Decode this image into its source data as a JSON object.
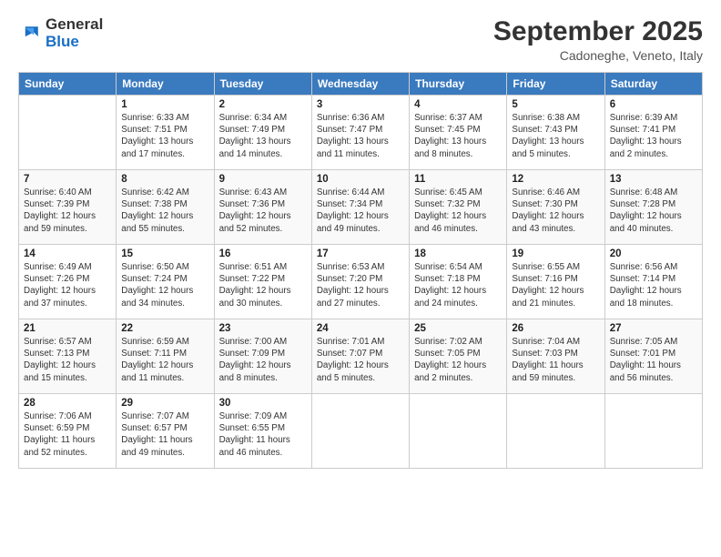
{
  "logo": {
    "general": "General",
    "blue": "Blue"
  },
  "title": "September 2025",
  "location": "Cadoneghe, Veneto, Italy",
  "days_of_week": [
    "Sunday",
    "Monday",
    "Tuesday",
    "Wednesday",
    "Thursday",
    "Friday",
    "Saturday"
  ],
  "weeks": [
    [
      {
        "day": null,
        "info": null
      },
      {
        "day": "1",
        "sunrise": "6:33 AM",
        "sunset": "7:51 PM",
        "daylight": "13 hours and 17 minutes."
      },
      {
        "day": "2",
        "sunrise": "6:34 AM",
        "sunset": "7:49 PM",
        "daylight": "13 hours and 14 minutes."
      },
      {
        "day": "3",
        "sunrise": "6:36 AM",
        "sunset": "7:47 PM",
        "daylight": "13 hours and 11 minutes."
      },
      {
        "day": "4",
        "sunrise": "6:37 AM",
        "sunset": "7:45 PM",
        "daylight": "13 hours and 8 minutes."
      },
      {
        "day": "5",
        "sunrise": "6:38 AM",
        "sunset": "7:43 PM",
        "daylight": "13 hours and 5 minutes."
      },
      {
        "day": "6",
        "sunrise": "6:39 AM",
        "sunset": "7:41 PM",
        "daylight": "13 hours and 2 minutes."
      }
    ],
    [
      {
        "day": "7",
        "sunrise": "6:40 AM",
        "sunset": "7:39 PM",
        "daylight": "12 hours and 59 minutes."
      },
      {
        "day": "8",
        "sunrise": "6:42 AM",
        "sunset": "7:38 PM",
        "daylight": "12 hours and 55 minutes."
      },
      {
        "day": "9",
        "sunrise": "6:43 AM",
        "sunset": "7:36 PM",
        "daylight": "12 hours and 52 minutes."
      },
      {
        "day": "10",
        "sunrise": "6:44 AM",
        "sunset": "7:34 PM",
        "daylight": "12 hours and 49 minutes."
      },
      {
        "day": "11",
        "sunrise": "6:45 AM",
        "sunset": "7:32 PM",
        "daylight": "12 hours and 46 minutes."
      },
      {
        "day": "12",
        "sunrise": "6:46 AM",
        "sunset": "7:30 PM",
        "daylight": "12 hours and 43 minutes."
      },
      {
        "day": "13",
        "sunrise": "6:48 AM",
        "sunset": "7:28 PM",
        "daylight": "12 hours and 40 minutes."
      }
    ],
    [
      {
        "day": "14",
        "sunrise": "6:49 AM",
        "sunset": "7:26 PM",
        "daylight": "12 hours and 37 minutes."
      },
      {
        "day": "15",
        "sunrise": "6:50 AM",
        "sunset": "7:24 PM",
        "daylight": "12 hours and 34 minutes."
      },
      {
        "day": "16",
        "sunrise": "6:51 AM",
        "sunset": "7:22 PM",
        "daylight": "12 hours and 30 minutes."
      },
      {
        "day": "17",
        "sunrise": "6:53 AM",
        "sunset": "7:20 PM",
        "daylight": "12 hours and 27 minutes."
      },
      {
        "day": "18",
        "sunrise": "6:54 AM",
        "sunset": "7:18 PM",
        "daylight": "12 hours and 24 minutes."
      },
      {
        "day": "19",
        "sunrise": "6:55 AM",
        "sunset": "7:16 PM",
        "daylight": "12 hours and 21 minutes."
      },
      {
        "day": "20",
        "sunrise": "6:56 AM",
        "sunset": "7:14 PM",
        "daylight": "12 hours and 18 minutes."
      }
    ],
    [
      {
        "day": "21",
        "sunrise": "6:57 AM",
        "sunset": "7:13 PM",
        "daylight": "12 hours and 15 minutes."
      },
      {
        "day": "22",
        "sunrise": "6:59 AM",
        "sunset": "7:11 PM",
        "daylight": "12 hours and 11 minutes."
      },
      {
        "day": "23",
        "sunrise": "7:00 AM",
        "sunset": "7:09 PM",
        "daylight": "12 hours and 8 minutes."
      },
      {
        "day": "24",
        "sunrise": "7:01 AM",
        "sunset": "7:07 PM",
        "daylight": "12 hours and 5 minutes."
      },
      {
        "day": "25",
        "sunrise": "7:02 AM",
        "sunset": "7:05 PM",
        "daylight": "12 hours and 2 minutes."
      },
      {
        "day": "26",
        "sunrise": "7:04 AM",
        "sunset": "7:03 PM",
        "daylight": "11 hours and 59 minutes."
      },
      {
        "day": "27",
        "sunrise": "7:05 AM",
        "sunset": "7:01 PM",
        "daylight": "11 hours and 56 minutes."
      }
    ],
    [
      {
        "day": "28",
        "sunrise": "7:06 AM",
        "sunset": "6:59 PM",
        "daylight": "11 hours and 52 minutes."
      },
      {
        "day": "29",
        "sunrise": "7:07 AM",
        "sunset": "6:57 PM",
        "daylight": "11 hours and 49 minutes."
      },
      {
        "day": "30",
        "sunrise": "7:09 AM",
        "sunset": "6:55 PM",
        "daylight": "11 hours and 46 minutes."
      },
      {
        "day": null,
        "info": null
      },
      {
        "day": null,
        "info": null
      },
      {
        "day": null,
        "info": null
      },
      {
        "day": null,
        "info": null
      }
    ]
  ],
  "labels": {
    "sunrise": "Sunrise:",
    "sunset": "Sunset:",
    "daylight": "Daylight:"
  }
}
